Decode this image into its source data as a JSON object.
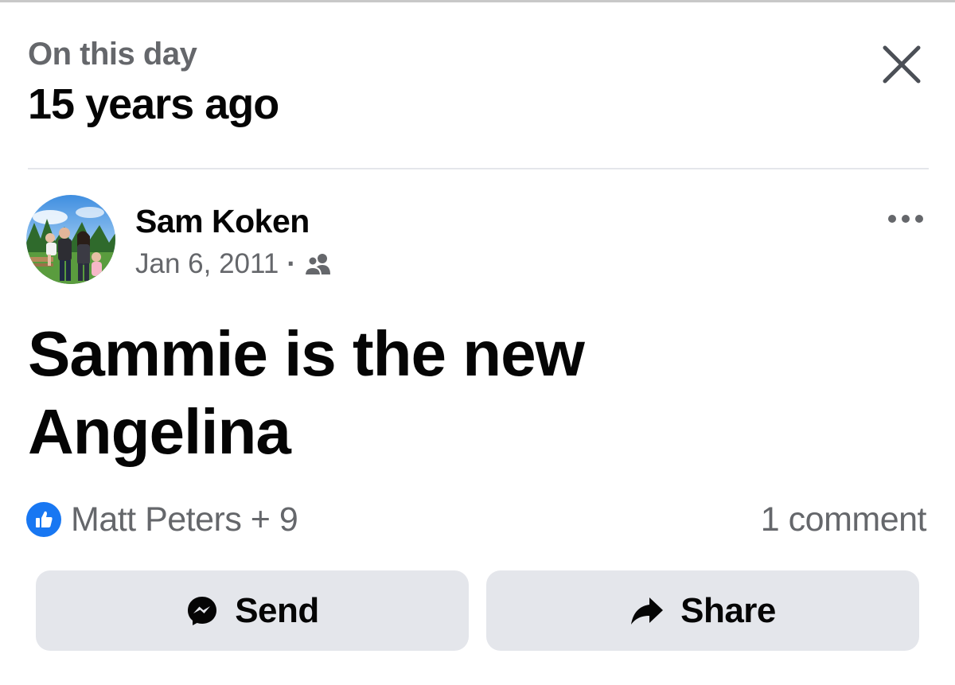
{
  "memory_header": {
    "kicker": "On this day",
    "title": "15 years ago"
  },
  "post": {
    "author": "Sam Koken",
    "date": "Jan 6, 2011",
    "meta_separator": "·",
    "audience_icon": "friends-icon",
    "text_lines": [
      "Sammie is the new",
      "Angelina"
    ]
  },
  "engagement": {
    "reaction_icon": "like-icon",
    "reactions_text": "Matt Peters + 9",
    "comments_text": "1 comment"
  },
  "actions": {
    "send_label": "Send",
    "send_icon": "messenger-icon",
    "share_label": "Share",
    "share_icon": "share-arrow-icon"
  },
  "colors": {
    "secondary_text": "#65676b",
    "primary_text": "#050505",
    "like_blue": "#1877f2",
    "button_bg": "#e4e6eb",
    "divider": "#e4e6eb"
  }
}
